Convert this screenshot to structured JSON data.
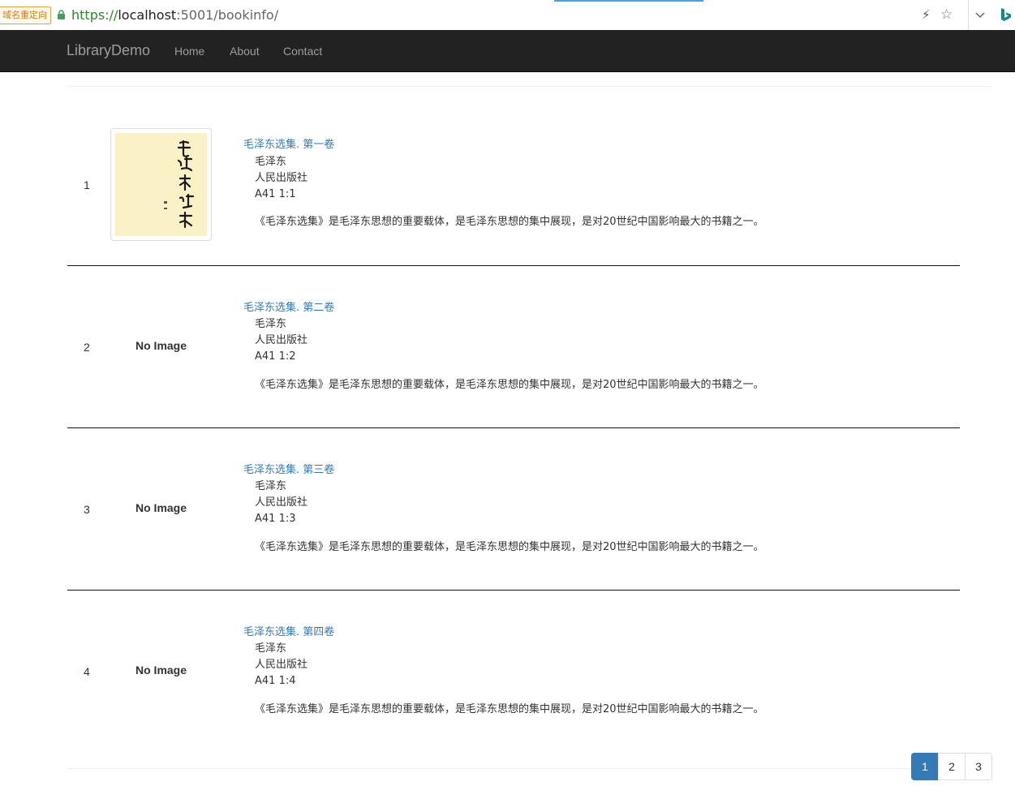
{
  "browser": {
    "redirect_tag": "域名重定向",
    "url_scheme": "https://",
    "url_host": "localhost",
    "url_rest": ":5001/bookinfo/"
  },
  "navbar": {
    "brand": "LibraryDemo",
    "links": [
      "Home",
      "About",
      "Contact"
    ]
  },
  "books": [
    {
      "index": "1",
      "has_image": true,
      "image_text": "毛泽东选集",
      "title": "毛泽东选集. 第一卷",
      "author": "毛泽东",
      "publisher": "人民出版社",
      "call_number": "A41 1:1",
      "description": "《毛泽东选集》是毛泽东思想的重要载体，是毛泽东思想的集中展现，是对20世纪中国影响最大的书籍之一。"
    },
    {
      "index": "2",
      "has_image": false,
      "no_image_label": "No Image",
      "title": "毛泽东选集. 第二卷",
      "author": "毛泽东",
      "publisher": "人民出版社",
      "call_number": "A41 1:2",
      "description": "《毛泽东选集》是毛泽东思想的重要载体，是毛泽东思想的集中展现，是对20世纪中国影响最大的书籍之一。"
    },
    {
      "index": "3",
      "has_image": false,
      "no_image_label": "No Image",
      "title": "毛泽东选集. 第三卷",
      "author": "毛泽东",
      "publisher": "人民出版社",
      "call_number": "A41 1:3",
      "description": "《毛泽东选集》是毛泽东思想的重要载体，是毛泽东思想的集中展现，是对20世纪中国影响最大的书籍之一。"
    },
    {
      "index": "4",
      "has_image": false,
      "no_image_label": "No Image",
      "title": "毛泽东选集. 第四卷",
      "author": "毛泽东",
      "publisher": "人民出版社",
      "call_number": "A41 1:4",
      "description": "《毛泽东选集》是毛泽东思想的重要载体，是毛泽东思想的集中展现，是对20世纪中国影响最大的书籍之一。"
    }
  ],
  "pagination": {
    "pages": [
      "1",
      "2",
      "3"
    ],
    "active": "1",
    "active_color": "#337ab7"
  },
  "colors": {
    "navbar_bg": "#222222",
    "link": "#337ab7"
  }
}
